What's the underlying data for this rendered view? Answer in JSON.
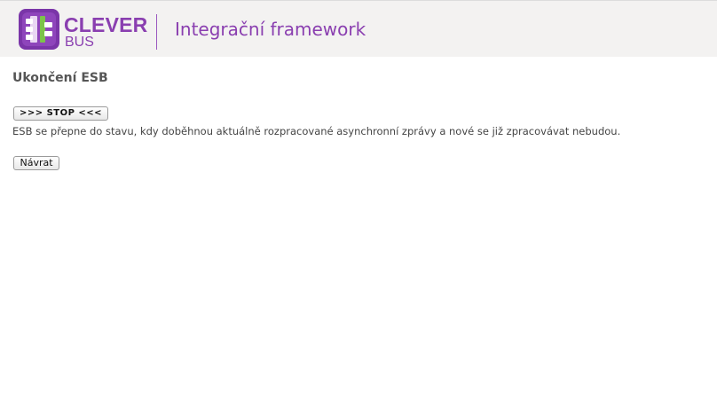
{
  "header": {
    "brand_name": "CLEVER",
    "brand_sub": "BUS",
    "app_title": "Integrační framework",
    "logo_icon": "clever-bus-logo-icon",
    "brand_color": "#8a3fb0",
    "logo_accent_color": "#7cc34a"
  },
  "main": {
    "title": "Ukončení ESB",
    "stop_button_label": ">>> STOP <<<",
    "description": "ESB se přepne do stavu, kdy doběhnou aktuálně rozpracované asynchronní zprávy a nové se již zpracovávat nebudou.",
    "back_button_label": "Návrat"
  }
}
